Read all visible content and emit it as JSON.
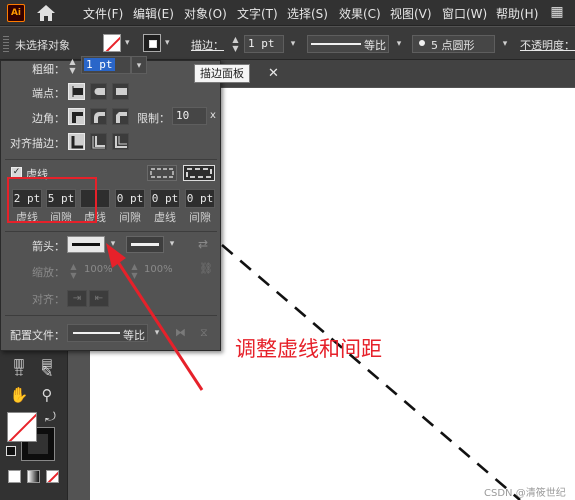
{
  "app": {
    "logo": "Ai",
    "menu": [
      "文件(F)",
      "编辑(E)",
      "对象(O)",
      "文字(T)",
      "选择(S)",
      "效果(C)",
      "视图(V)",
      "窗口(W)",
      "帮助(H)"
    ]
  },
  "control_bar": {
    "selection": "未选择对象",
    "stroke_label": "描边：",
    "stroke_weight": "1 pt",
    "profile_label": "等比",
    "brush_label": "5 点圆形",
    "opacity_label": "不透明度："
  },
  "tooltip": "描边面板",
  "stroke_panel": {
    "weight_label": "粗细：",
    "weight_value": "1 pt",
    "cap_label": "端点：",
    "corner_label": "边角：",
    "limit_label": "限制：",
    "limit_value": "10",
    "limit_unit": "x",
    "align_label": "对齐描边：",
    "dashed_label": "虚线",
    "dashed_checked": true,
    "dash_fields": [
      {
        "value": "2 pt",
        "label": "虚线"
      },
      {
        "value": "5 pt",
        "label": "间隙"
      },
      {
        "value": "",
        "label": "虚线"
      },
      {
        "value": "0 pt",
        "label": "间隙"
      },
      {
        "value": "0 pt",
        "label": "虚线"
      },
      {
        "value": "0 pt",
        "label": "间隙"
      }
    ],
    "arrow_label": "箭头：",
    "scale_label": "缩放：",
    "scale_start": "100%",
    "scale_end": "100%",
    "align_arrow_label": "对齐：",
    "profile_label": "配置文件：",
    "profile_value": "等比"
  },
  "annotation": {
    "text": "调整虚线和间距",
    "color": "#e6212a"
  },
  "watermark": "CSDN @清筱世纪",
  "colors": {
    "accent_red": "#e6212a",
    "panel_bg": "#535353",
    "menubar_bg": "#323232"
  }
}
